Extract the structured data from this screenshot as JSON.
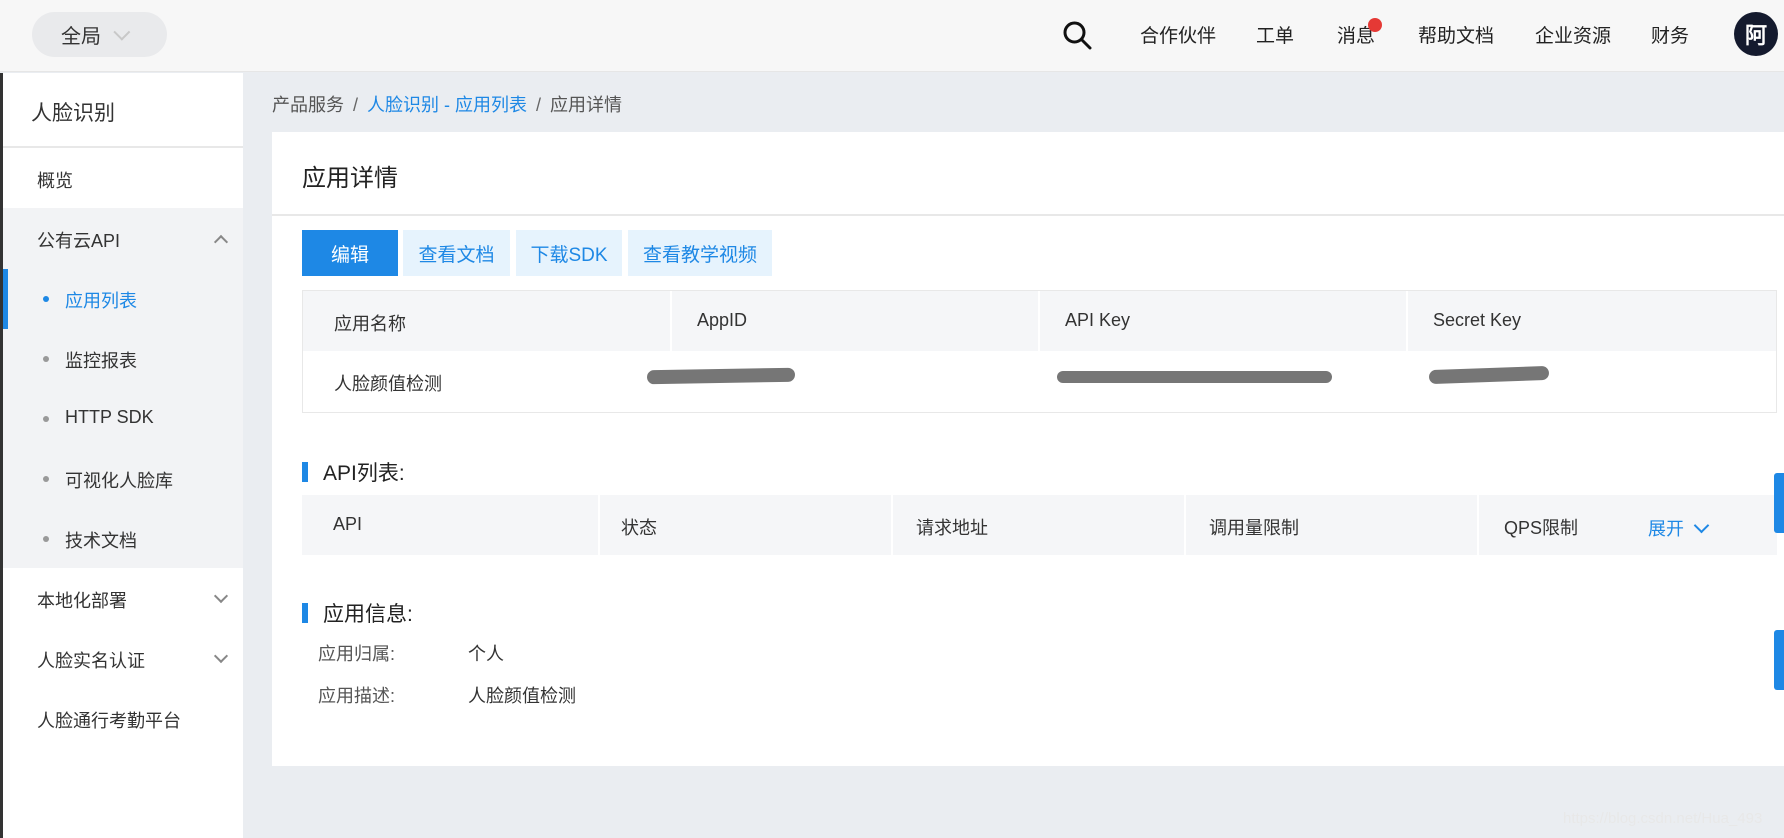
{
  "topbar": {
    "scope": "全局",
    "nav": [
      "合作伙伴",
      "工单",
      "消息",
      "帮助文档",
      "企业资源",
      "财务"
    ],
    "avatar": "阿"
  },
  "sidebar": {
    "title": "人脸识别",
    "overview": "概览",
    "public_api": "公有云API",
    "sub_items": [
      "应用列表",
      "监控报表",
      "HTTP SDK",
      "可视化人脸库",
      "技术文档"
    ],
    "local_deploy": "本地化部署",
    "realname": "人脸实名认证",
    "attendance": "人脸通行考勤平台"
  },
  "breadcrumb": {
    "root": "产品服务",
    "link": "人脸识别 - 应用列表",
    "current": "应用详情"
  },
  "panel": {
    "title": "应用详情",
    "buttons": {
      "edit": "编辑",
      "docs": "查看文档",
      "sdk": "下载SDK",
      "video": "查看教学视频"
    },
    "app_table": {
      "headers": [
        "应用名称",
        "AppID",
        "API Key",
        "Secret Key"
      ],
      "row": {
        "name": "人脸颜值检测"
      }
    },
    "api_section": "API列表:",
    "api_table": {
      "headers": [
        "API",
        "状态",
        "请求地址",
        "调用量限制",
        "QPS限制"
      ],
      "expand": "展开"
    },
    "info_section": "应用信息:",
    "info": [
      {
        "label": "应用归属:",
        "value": "个人"
      },
      {
        "label": "应用描述:",
        "value": "人脸颜值检测"
      }
    ]
  },
  "watermark": "https://blog.csdn.net/Hua_493"
}
